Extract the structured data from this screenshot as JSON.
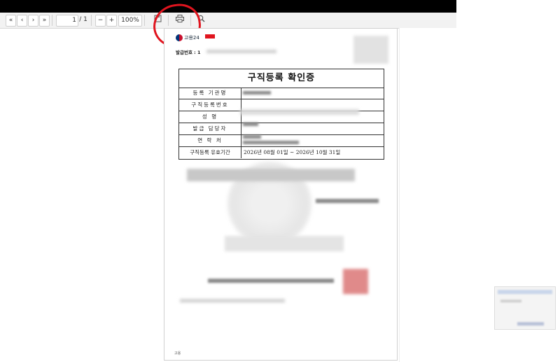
{
  "toolbar": {
    "first_icon": "«",
    "prev_icon": "‹",
    "next_icon": "›",
    "last_icon": "»",
    "page_current": "1",
    "page_total": "/ 1",
    "zoom_out": "−",
    "zoom_in": "+",
    "zoom_level": "100%",
    "save_icon": "floppy-icon",
    "print_icon": "printer-icon",
    "search_icon": "magnifier-icon"
  },
  "document": {
    "logo_text": "고용24",
    "issue_label": "발급번호 : 1",
    "title": "구직등록 확인증",
    "rows": [
      {
        "label": "등록 기관명",
        "value": ""
      },
      {
        "label": "구직등록번호",
        "value": ""
      },
      {
        "label": "성 명",
        "value": ""
      },
      {
        "label": "발급 담당자",
        "value": ""
      },
      {
        "label": "연 락 처",
        "value": ""
      },
      {
        "label": "구직등록 유효기간",
        "value": "2026년 08월 01일 ~ 2026년 10월 31일"
      }
    ],
    "footer_text": "고용"
  },
  "colors": {
    "annotation": "#e0141e",
    "toolbar_bg": "#f2f2f2",
    "topbar": "#000000"
  }
}
